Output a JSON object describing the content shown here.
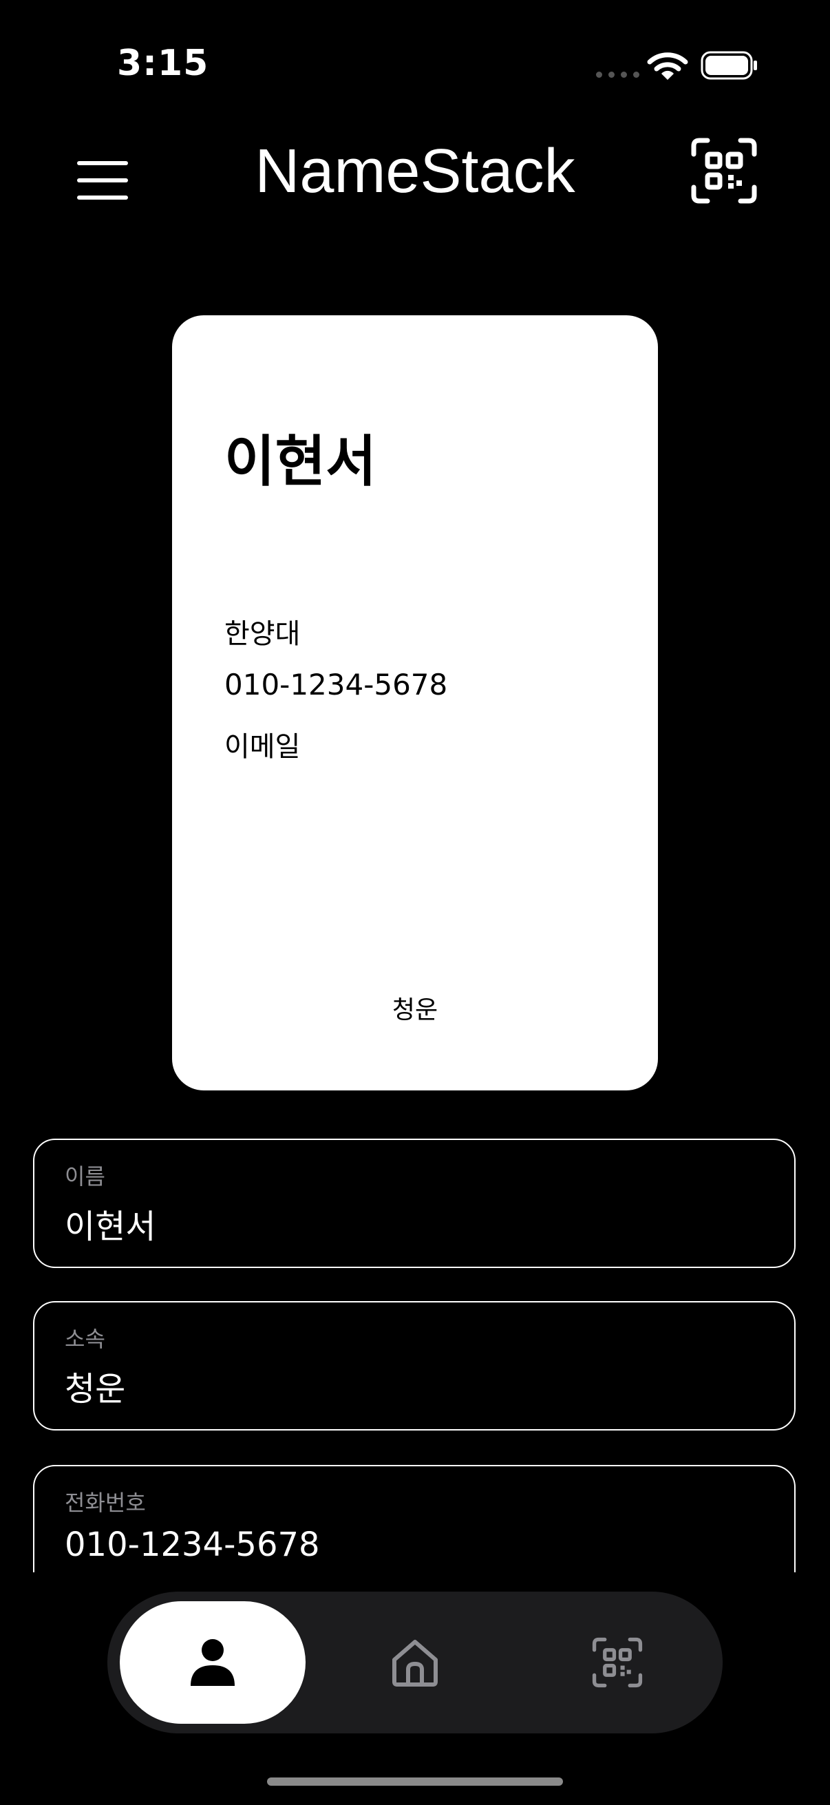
{
  "status_bar": {
    "time": "3:15"
  },
  "header": {
    "title": "NameStack",
    "menu_icon": "hamburger-menu-icon",
    "qr_icon": "qr-code-icon"
  },
  "card": {
    "name": "이현서",
    "affiliation": "한양대",
    "phone": "010-1234-5678",
    "email": "이메일",
    "footer": "청운"
  },
  "fields": [
    {
      "label": "이름",
      "value": "이현서"
    },
    {
      "label": "소속",
      "value": "청운"
    },
    {
      "label": "전화번호",
      "value": "010-1234-5678"
    }
  ],
  "tab_bar": {
    "tabs": [
      {
        "icon": "person-icon",
        "active": true
      },
      {
        "icon": "home-icon",
        "active": false
      },
      {
        "icon": "qr-code-icon",
        "active": false
      }
    ]
  },
  "colors": {
    "background": "#000000",
    "card": "#ffffff",
    "tab_bar": "#1c1c1e",
    "field_label": "#8e8e93"
  }
}
